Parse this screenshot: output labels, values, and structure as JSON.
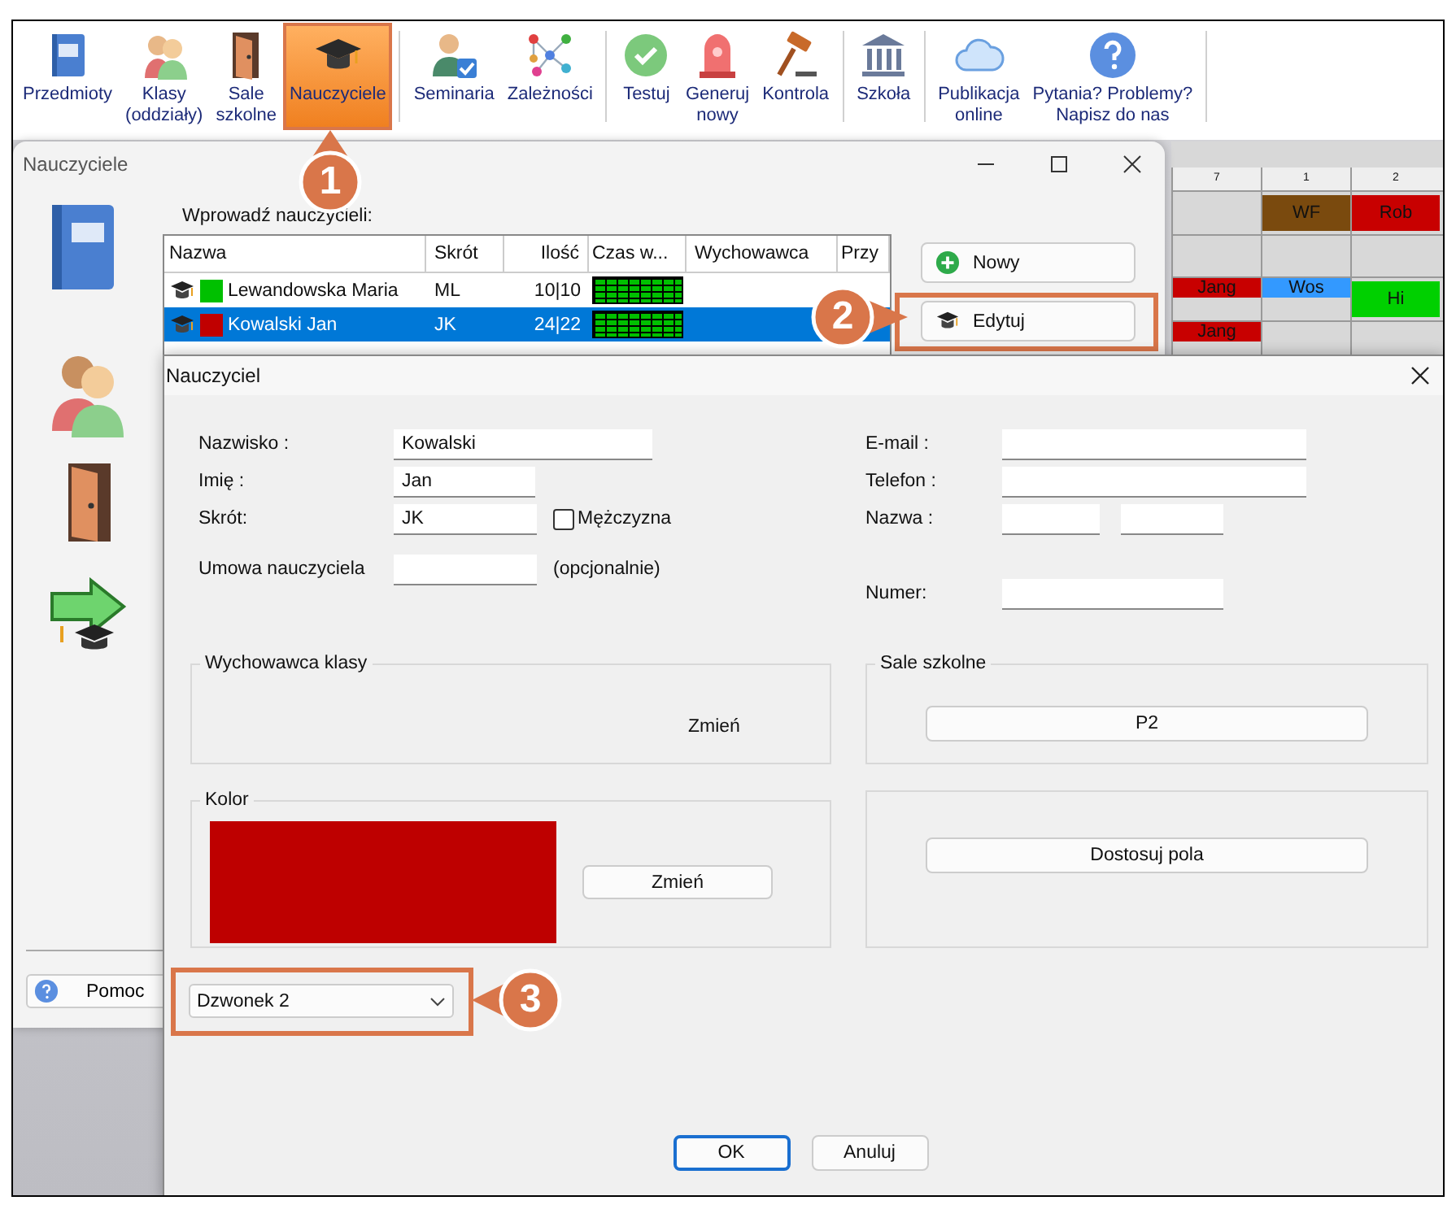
{
  "toolbar": {
    "groups": [
      [
        {
          "label": "Przedmioty",
          "selected": false
        },
        {
          "label": "Klasy\n(oddziały)",
          "selected": false
        },
        {
          "label": "Sale\nszkolne",
          "selected": false
        },
        {
          "label": "Nauczyciele",
          "selected": true
        }
      ],
      [
        {
          "label": "Seminaria",
          "selected": false
        },
        {
          "label": "Zależności",
          "selected": false
        }
      ],
      [
        {
          "label": "Testuj",
          "selected": false
        },
        {
          "label": "Generuj\nnowy",
          "selected": false
        },
        {
          "label": "Kontrola",
          "selected": false
        }
      ],
      [
        {
          "label": "Szkoła",
          "selected": false
        }
      ],
      [
        {
          "label": "Publikacja\nonline",
          "selected": false
        },
        {
          "label": "Pytania? Problemy?\nNapisz do nas",
          "selected": false
        }
      ]
    ]
  },
  "timetable": {
    "columns": [
      "7",
      "1",
      "2"
    ],
    "rows": [
      [
        {
          "kind": "empty"
        },
        {
          "kind": "block",
          "text": "WF",
          "color": "#7a4a0e"
        },
        {
          "kind": "block",
          "text": "Rob",
          "color": "#c80000"
        }
      ],
      [
        {
          "kind": "empty"
        },
        {
          "kind": "empty"
        },
        {
          "kind": "empty"
        }
      ],
      [
        {
          "kind": "bar",
          "text": "Jang",
          "color": "#c80000"
        },
        {
          "kind": "bar",
          "text": "Wos",
          "color": "#3399ff"
        },
        {
          "kind": "block",
          "text": "Hi",
          "color": "#00d000"
        }
      ],
      [
        {
          "kind": "bar",
          "text": "Jang",
          "color": "#c80000"
        },
        {
          "kind": "empty"
        },
        {
          "kind": "empty"
        }
      ]
    ]
  },
  "teachers_window": {
    "title": "Nauczyciele",
    "prompt": "Wprowadź nauczycieli:",
    "table": {
      "columns": [
        "Nazwa",
        "Skrót",
        "Ilość",
        "Czas w...",
        "Wychowawca",
        "Przy"
      ],
      "rows": [
        {
          "name": "Lewandowska Maria",
          "color": "#00c000",
          "abbr": "ML",
          "count": "10|10",
          "selected": false
        },
        {
          "name": "Kowalski Jan",
          "color": "#c00000",
          "abbr": "JK",
          "count": "24|22",
          "selected": true
        }
      ]
    },
    "buttons": [
      {
        "label": "Nowy",
        "kind": "add",
        "highlighted": false
      },
      {
        "label": "Edytuj",
        "kind": "edit",
        "highlighted": true
      }
    ],
    "help_button": "Pomoc"
  },
  "dialog": {
    "title": "Nauczyciel",
    "left_fields": [
      {
        "label": "Nazwisko :",
        "value": "Kowalski"
      },
      {
        "label": "Imię :",
        "value": "Jan"
      },
      {
        "label": "Skrót:",
        "value": "JK",
        "checkbox": {
          "label": "Mężczyzna",
          "checked": false
        }
      },
      {
        "label": "Umowa nauczyciela",
        "note": "(opcjonalnie)"
      }
    ],
    "right_fields": [
      {
        "label": "E-mail :",
        "kind": "single"
      },
      {
        "label": "Telefon :",
        "kind": "single"
      },
      {
        "label": "Nazwa :",
        "kind": "pair"
      },
      {
        "label": "Numer:",
        "kind": "single"
      }
    ],
    "class_teacher": {
      "title": "Wychowawca klasy",
      "button": "Zmień"
    },
    "rooms": {
      "title": "Sale szkolne",
      "button": "P2"
    },
    "color_group": {
      "title": "Kolor",
      "color": "#be0000",
      "button": "Zmień"
    },
    "fields_button": "Dostosuj pola",
    "bell_select": {
      "value": "Dzwonek 2",
      "highlighted": true
    },
    "buttons": [
      {
        "label": "OK",
        "kind": "default"
      },
      {
        "label": "Anuluj",
        "kind": "normal"
      }
    ]
  },
  "callouts": [
    {
      "number": "1"
    },
    {
      "number": "2"
    },
    {
      "number": "3"
    }
  ]
}
